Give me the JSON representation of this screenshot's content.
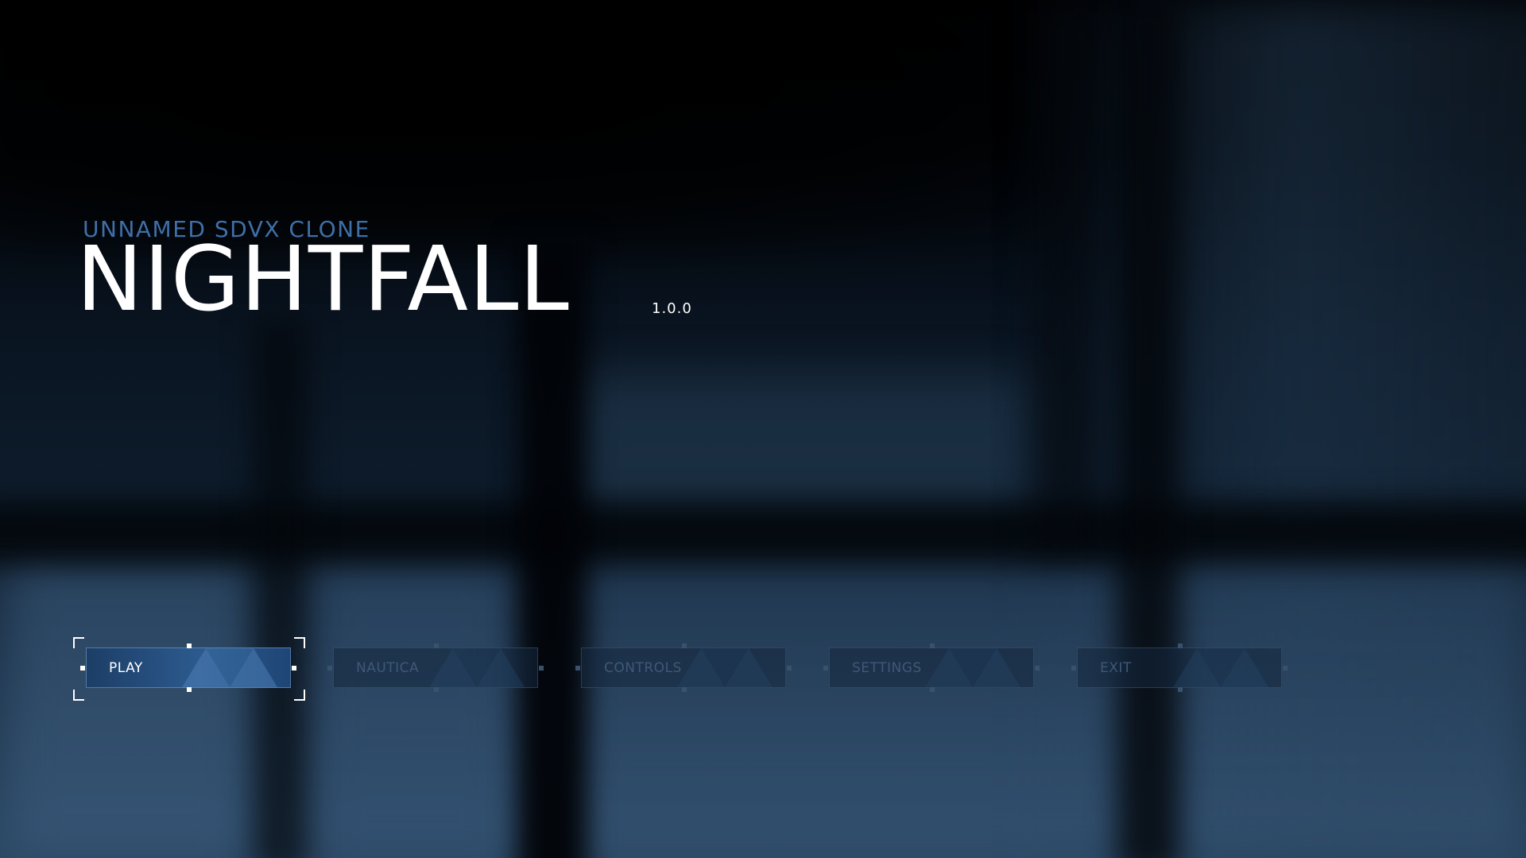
{
  "title": {
    "subtitle": "UNNAMED SDVX CLONE",
    "name": "NIGHTFALL",
    "version": "1.0.0"
  },
  "menu": {
    "selected": "PLAY",
    "items": [
      {
        "label": "PLAY"
      },
      {
        "label": "NAUTICA"
      },
      {
        "label": "CONTROLS"
      },
      {
        "label": "SETTINGS"
      },
      {
        "label": "EXIT"
      }
    ]
  },
  "colors": {
    "accent": "#3f6fa8",
    "active_button": "#2c5a8e",
    "inactive_text": "#3f5878"
  }
}
